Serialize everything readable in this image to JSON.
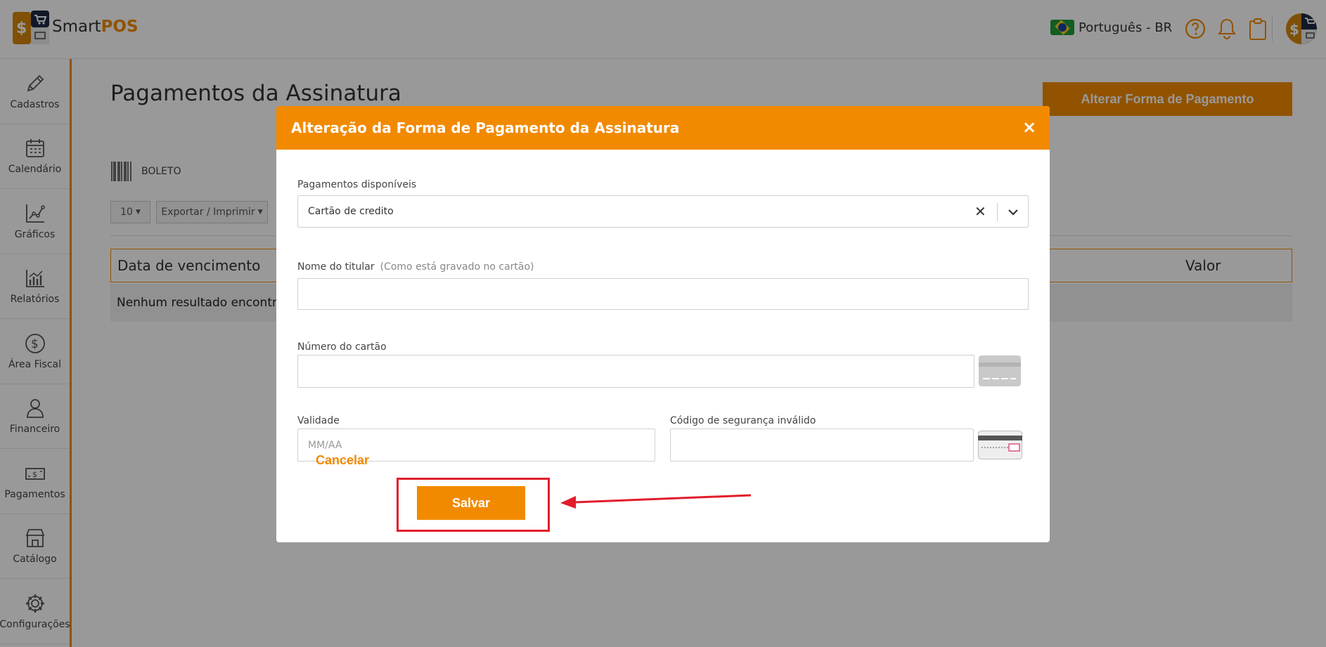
{
  "header": {
    "brand_plain": "Smart",
    "brand_bold": "POS",
    "language": "Português - BR"
  },
  "sidebar": {
    "items": [
      {
        "label": "Cadastros",
        "icon": "pencil-icon"
      },
      {
        "label": "Calendário",
        "icon": "calendar-icon"
      },
      {
        "label": "Gráficos",
        "icon": "line-chart-icon"
      },
      {
        "label": "Relatórios",
        "icon": "bar-chart-icon"
      },
      {
        "label": "Área Fiscal",
        "icon": "dollar-circle-icon"
      },
      {
        "label": "Financeiro",
        "icon": "person-icon"
      },
      {
        "label": "Pagamentos",
        "icon": "banknote-icon"
      },
      {
        "label": "Catálogo",
        "icon": "store-icon"
      },
      {
        "label": "Configurações",
        "icon": "gear-icon"
      }
    ]
  },
  "main": {
    "title": "Pagamentos da Assinatura",
    "alter_button": "Alterar Forma de Pagamento",
    "payment_type": "BOLETO",
    "page_size": "10",
    "export_label": "Exportar / Imprimir",
    "table": {
      "columns": [
        "Data de vencimento",
        "Valor"
      ],
      "empty_text": "Nenhum resultado encontrado"
    }
  },
  "modal": {
    "title": "Alteração da Forma de Pagamento da Assinatura",
    "close_symbol": "×",
    "payments_label": "Pagamentos disponíveis",
    "payments_value": "Cartão de credito",
    "holder_label": "Nome do titular",
    "holder_hint": "(Como está gravado no cartão)",
    "holder_value": "",
    "card_number_label": "Número do cartão",
    "card_number_value": "",
    "expiry_label": "Validade",
    "expiry_placeholder": "MM/AA",
    "cvv_label": "Código de segurança inválido",
    "cvv_value": "",
    "cancel_label": "Cancelar",
    "save_label": "Salvar"
  },
  "colors": {
    "accent": "#f28a00",
    "annotation": "#e11d2a"
  }
}
